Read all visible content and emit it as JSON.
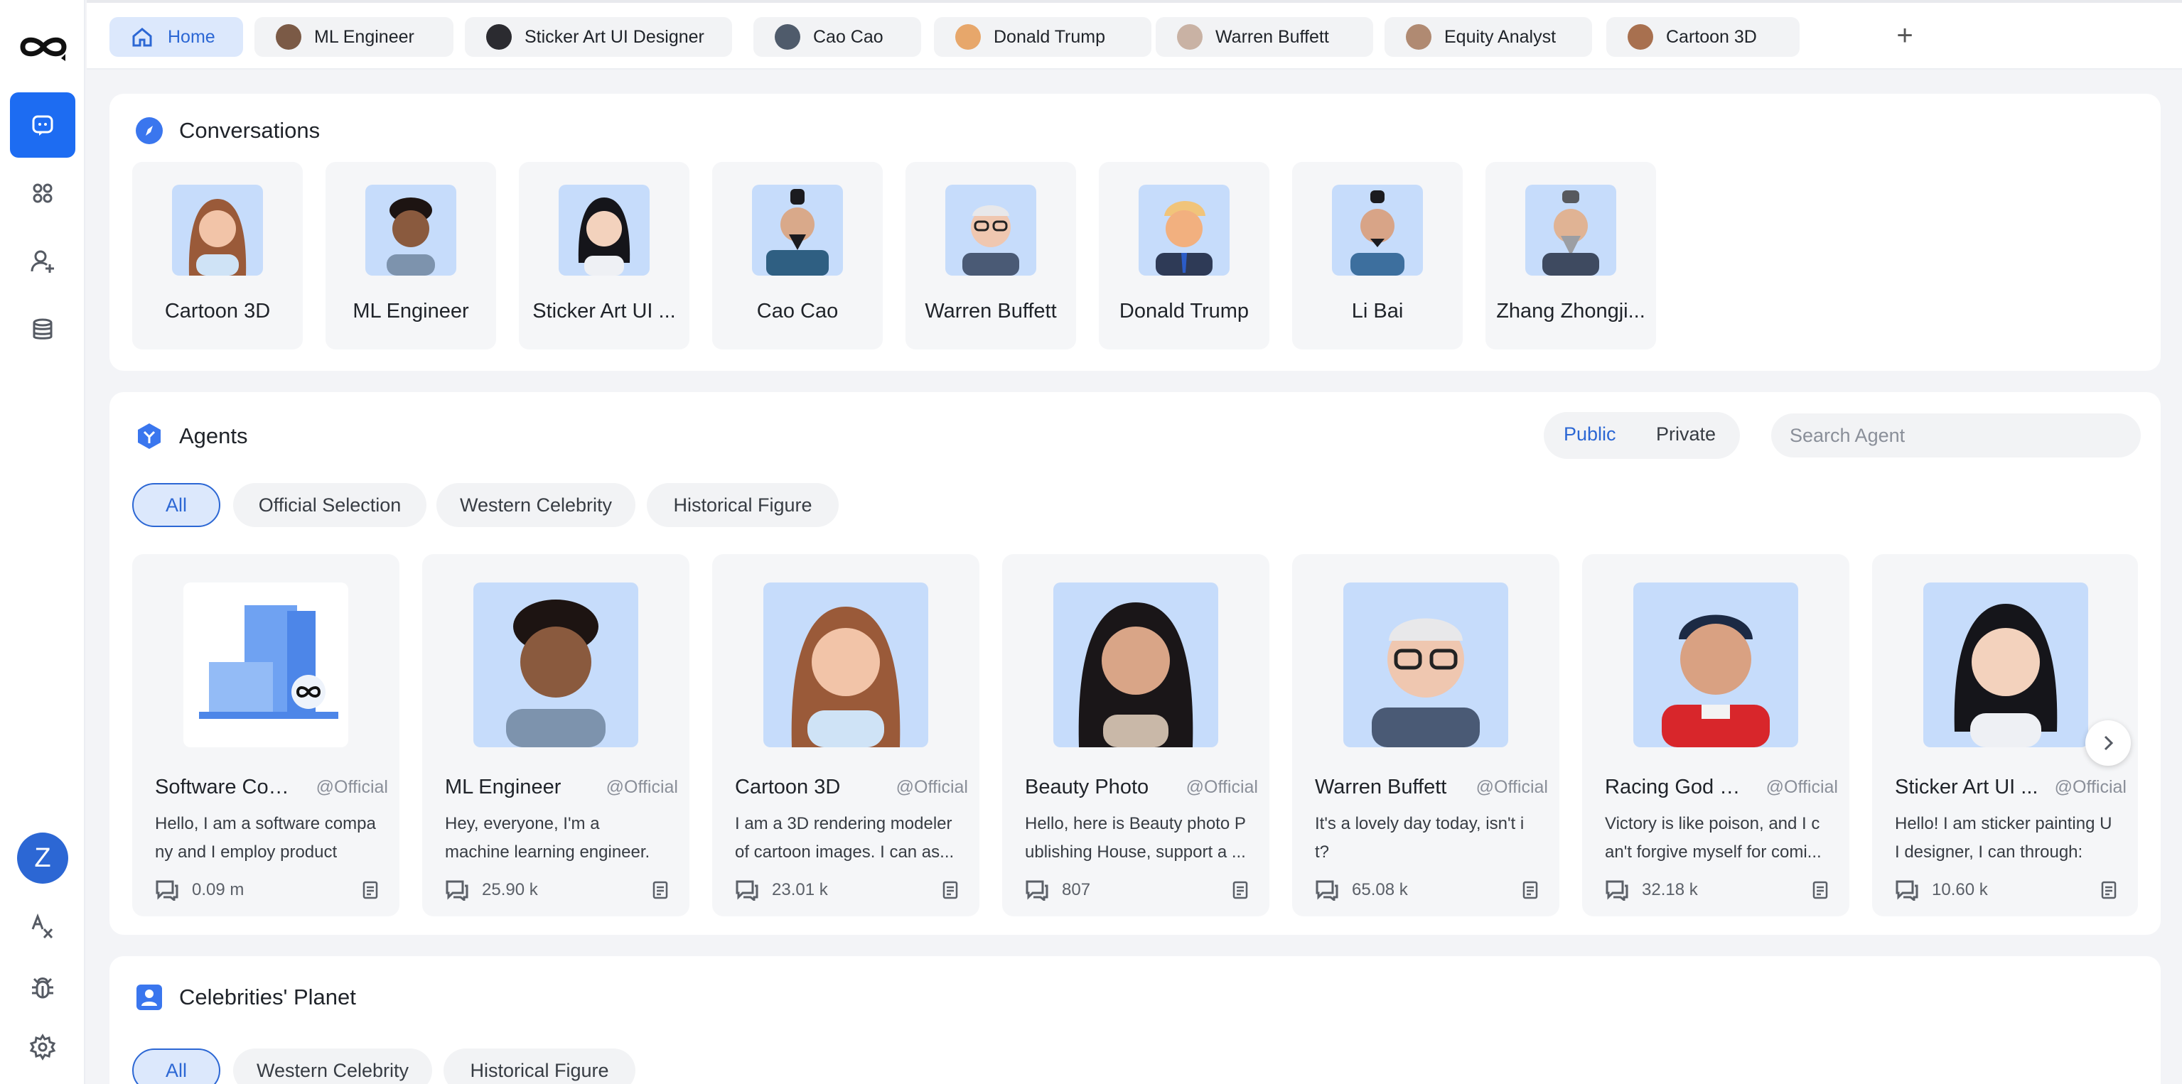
{
  "sidebar": {
    "user_initial": "Z",
    "icons": [
      "chat-icon",
      "apps-icon",
      "add-user-icon",
      "database-icon",
      "translate-icon",
      "bug-icon",
      "settings-icon"
    ]
  },
  "tabs": [
    {
      "label": "Home",
      "active": true
    },
    {
      "label": "ML Engineer"
    },
    {
      "label": "Sticker Art UI Designer"
    },
    {
      "label": "Cao Cao"
    },
    {
      "label": "Donald Trump"
    },
    {
      "label": "Warren Buffett"
    },
    {
      "label": "Equity Analyst"
    },
    {
      "label": "Cartoon 3D"
    }
  ],
  "conversations": {
    "title": "Conversations",
    "items": [
      {
        "name": "Cartoon 3D"
      },
      {
        "name": "ML Engineer"
      },
      {
        "name": "Sticker Art UI ..."
      },
      {
        "name": "Cao Cao"
      },
      {
        "name": "Warren Buffett"
      },
      {
        "name": "Donald Trump"
      },
      {
        "name": "Li Bai"
      },
      {
        "name": "Zhang Zhongji..."
      }
    ]
  },
  "agents": {
    "title": "Agents",
    "visibility": {
      "public": "Public",
      "private": "Private",
      "selected": "Public"
    },
    "search_placeholder": "Search Agent",
    "filters": [
      "All",
      "Official Selection",
      "Western Celebrity",
      "Historical Figure"
    ],
    "active_filter": "All",
    "items": [
      {
        "name": "Software Com...",
        "tag": "@Official",
        "desc": "Hello, I am a software compa ny and I employ product ma...",
        "count": "0.09 m"
      },
      {
        "name": "ML Engineer",
        "tag": "@Official",
        "desc": "Hey, everyone, I'm a machine learning engineer. You can ...",
        "count": "25.90 k"
      },
      {
        "name": "Cartoon 3D",
        "tag": "@Official",
        "desc": "I am a 3D rendering modeler of cartoon images. I can as...",
        "count": "23.01 k"
      },
      {
        "name": "Beauty Photo",
        "tag": "@Official",
        "desc": "Hello, here is Beauty photo P ublishing House, support a ...",
        "count": "807"
      },
      {
        "name": "Warren Buffett",
        "tag": "@Official",
        "desc": "It's a lovely day today, isn't i t?",
        "count": "65.08 k"
      },
      {
        "name": "Racing God Se...",
        "tag": "@Official",
        "desc": "Victory is like poison, and I c an't forgive myself for comi...",
        "count": "32.18 k"
      },
      {
        "name": "Sticker Art UI ...",
        "tag": "@Official",
        "desc": "Hello! I am sticker painting U I designer, I can through: sti...",
        "count": "10.60 k"
      }
    ]
  },
  "celebrities": {
    "title": "Celebrities' Planet",
    "filters": [
      "All",
      "Western Celebrity",
      "Historical Figure"
    ],
    "active_filter": "All"
  },
  "colors": {
    "accent": "#2c67d4",
    "accent_light": "#dce8fc",
    "avatar_bg": "#c6dcfb",
    "card_bg": "#f5f6f8"
  }
}
